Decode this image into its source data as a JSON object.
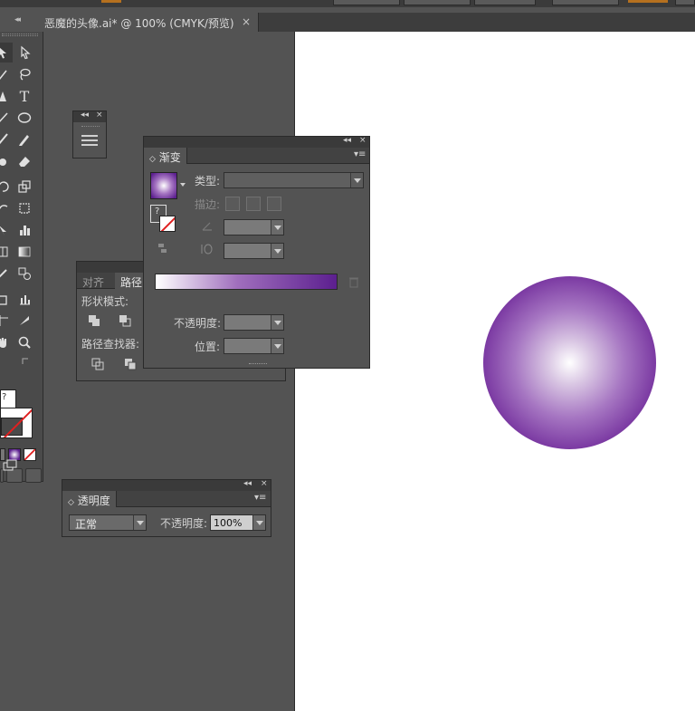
{
  "document": {
    "tab_title": "恶魔的头像.ai* @ 100% (CMYK/预览)",
    "close_glyph": "×",
    "collapse_glyph": "◂◂"
  },
  "panel_controls": {
    "collapse": "◂◂",
    "close": "×",
    "menu": "▾≡",
    "tab_toggle": "◇"
  },
  "gradient_panel": {
    "tab_label": "渐变",
    "type_label": "类型:",
    "stroke_label": "描边:",
    "opacity_label": "不透明度:",
    "location_label": "位置:",
    "swatch_question": "?",
    "gradient_colors": [
      "#ffffff",
      "#5c1f8f"
    ]
  },
  "pathfinder_panel": {
    "tabs": [
      "对齐",
      "路径"
    ],
    "shape_modes_label": "形状模式:",
    "pathfinders_label": "路径查找器:"
  },
  "transparency_panel": {
    "tab_label": "透明度",
    "blend_mode_value": "正常",
    "opacity_label": "不透明度:",
    "opacity_value": "100%"
  },
  "toolbar": {
    "question_mark": "?",
    "type_tool_glyph": "T"
  },
  "colors": {
    "workspace": "#535353",
    "panel": "#535353",
    "artboard": "#ffffff",
    "gradient_start": "#ffffff",
    "gradient_end": "#5c1f8f",
    "accent_orange": "#b5701f"
  }
}
